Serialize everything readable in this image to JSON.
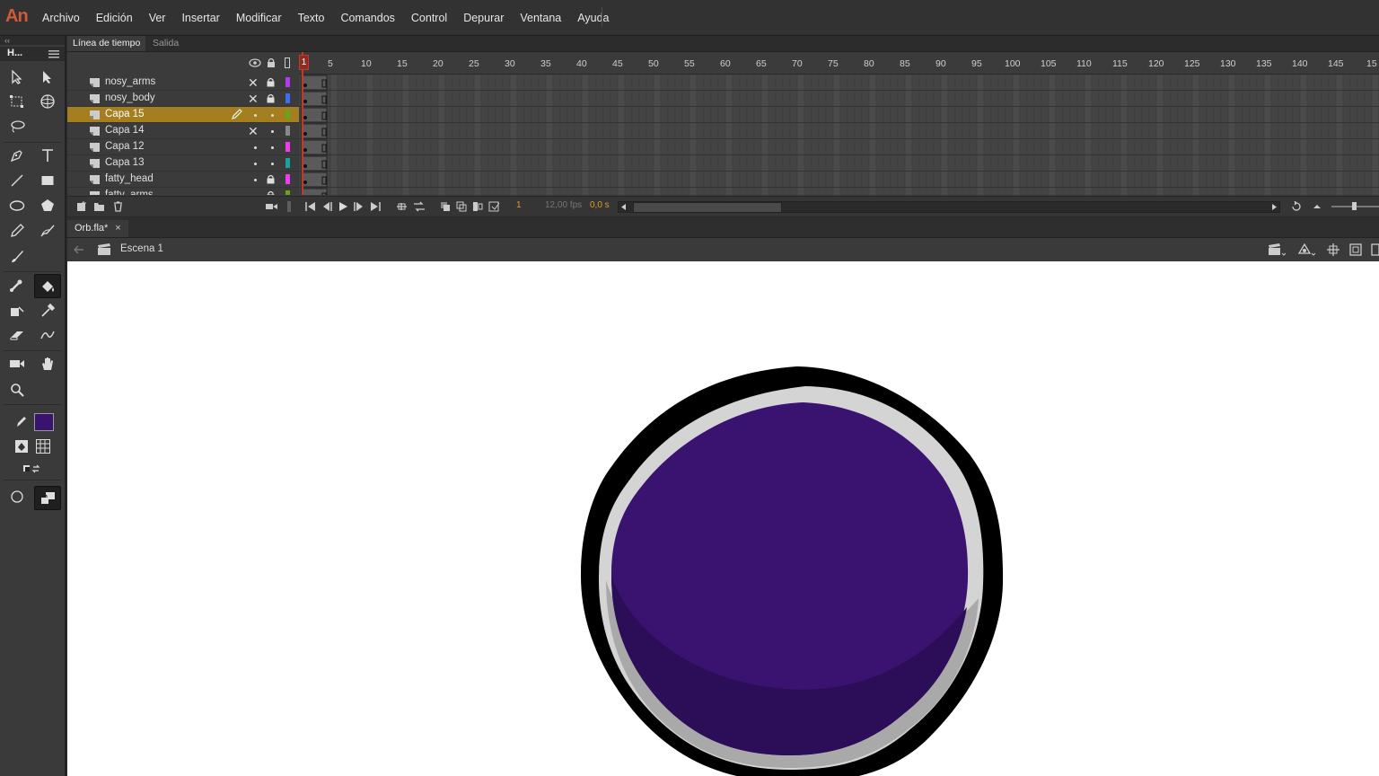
{
  "app": {
    "logo": "An"
  },
  "menu": [
    "Archivo",
    "Edición",
    "Ver",
    "Insertar",
    "Modificar",
    "Texto",
    "Comandos",
    "Control",
    "Depurar",
    "Ventana",
    "Ayuda"
  ],
  "tools_panel": {
    "collapse": "‹‹",
    "title": "H...",
    "fill_color": "#3a1270"
  },
  "timeline": {
    "tabs": [
      "Línea de tiempo",
      "Salida"
    ],
    "playhead_frame": "1",
    "ruler_labels": [
      "5",
      "10",
      "15",
      "20",
      "25",
      "30",
      "35",
      "40",
      "45",
      "50",
      "55",
      "60",
      "65",
      "70",
      "75",
      "80",
      "85",
      "90",
      "95",
      "100",
      "105",
      "110",
      "115",
      "120",
      "125",
      "130",
      "135",
      "140",
      "145",
      "15"
    ],
    "layers": [
      {
        "name": "nosy_arms",
        "hidden": true,
        "locked": true,
        "color": "#b03cf0"
      },
      {
        "name": "nosy_body",
        "hidden": true,
        "locked": true,
        "color": "#3c6cf0"
      },
      {
        "name": "Capa 15",
        "hidden": false,
        "locked": false,
        "color": "#6aa21c",
        "selected": true
      },
      {
        "name": "Capa 14",
        "hidden": true,
        "locked": false,
        "color": "#888888"
      },
      {
        "name": "Capa 12",
        "hidden": false,
        "locked": false,
        "color": "#f03cf0"
      },
      {
        "name": "Capa 13",
        "hidden": false,
        "locked": false,
        "color": "#1ca0a0"
      },
      {
        "name": "fatty_head",
        "hidden": false,
        "locked": true,
        "color": "#f03cf0"
      },
      {
        "name": "fatty_arms",
        "hidden": false,
        "locked": true,
        "color": "#6aa21c"
      }
    ],
    "current_frame": "1",
    "fps": "12,00 fps",
    "elapsed": "0,0 s"
  },
  "document": {
    "tab": "Orb.fla*",
    "close": "×",
    "scene": "Escena 1"
  },
  "stage": {
    "orb_fill": "#3a1270",
    "orb_shadow": "#2c0d57",
    "ring": "#d4d4d4",
    "outline": "#000000"
  }
}
